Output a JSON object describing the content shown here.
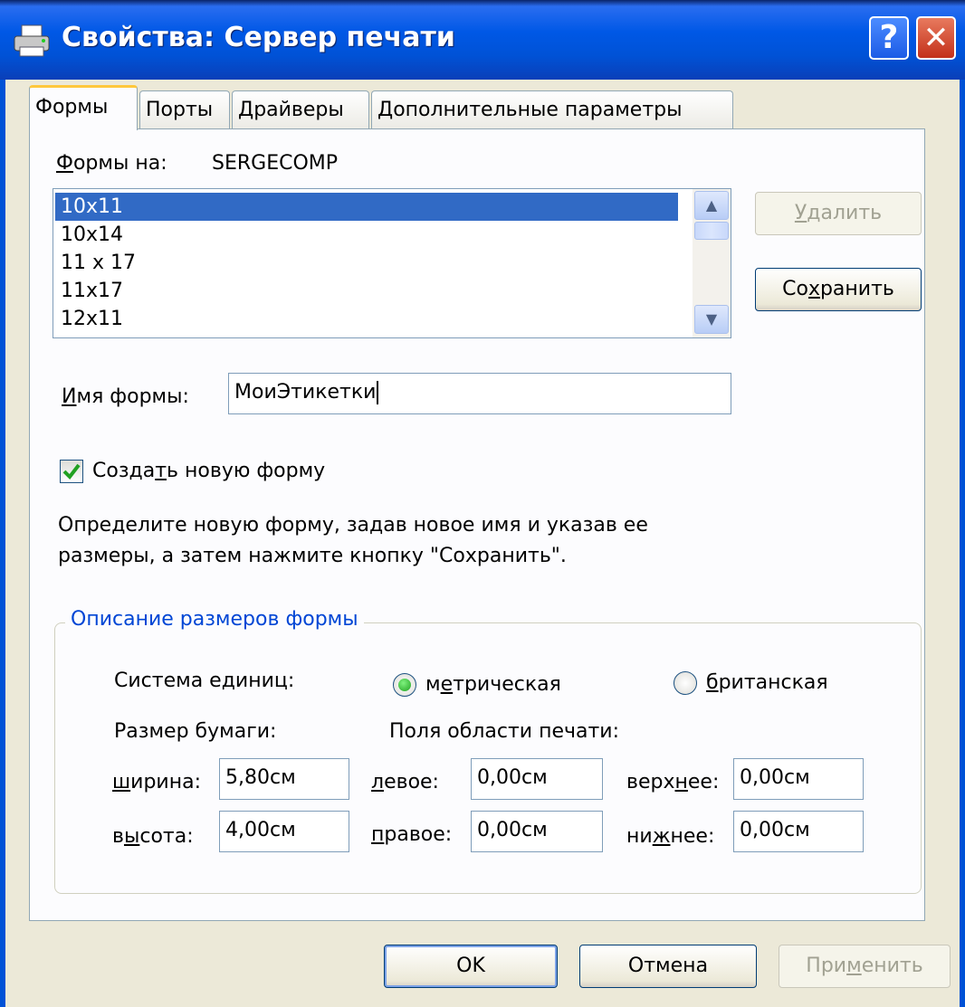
{
  "window": {
    "title": "Свойства: Сервер печати"
  },
  "tabs": [
    {
      "label": "Формы",
      "active": true
    },
    {
      "label": "Порты",
      "active": false
    },
    {
      "label": "Драйверы",
      "active": false
    },
    {
      "label": "Дополнительные параметры",
      "active": false
    }
  ],
  "forms_on": {
    "label": "Формы на:",
    "server": "SERGECOMP"
  },
  "forms_list": {
    "items": [
      "10x11",
      "10x14",
      "11 x 17",
      "11x17",
      "12x11"
    ],
    "selected_index": 0
  },
  "buttons": {
    "delete": "Удалить",
    "save": "Сохранить",
    "ok": "OK",
    "cancel": "Отмена",
    "apply": "Применить"
  },
  "form_name": {
    "label": "Имя формы:",
    "value": "МоиЭтикетки"
  },
  "create_new": {
    "label": "Создать новую форму",
    "checked": true
  },
  "hint": {
    "line1": "Определите новую форму, задав новое имя и указав ее",
    "line2": "размеры, а затем нажмите кнопку \"Сохранить\"."
  },
  "group": {
    "title": "Описание размеров формы",
    "units_label": "Система единиц:",
    "metric_label": "метрическая",
    "imperial_label": "британская",
    "selected_units": "metric",
    "paper_size_label": "Размер бумаги:",
    "margins_label": "Поля области печати:",
    "width": {
      "label": "ширина:",
      "value": "5,80см"
    },
    "height": {
      "label": "высота:",
      "value": "4,00см"
    },
    "left": {
      "label": "левое:",
      "value": "0,00см"
    },
    "right": {
      "label": "правое:",
      "value": "0,00см"
    },
    "top": {
      "label": "верхнее:",
      "value": "0,00см"
    },
    "bottom": {
      "label": "нижнее:",
      "value": "0,00см"
    }
  },
  "colors": {
    "titlebar": "#0052d6",
    "selection": "#316ac5",
    "group_title": "#0046d5",
    "radio_selected": "#21a121"
  }
}
